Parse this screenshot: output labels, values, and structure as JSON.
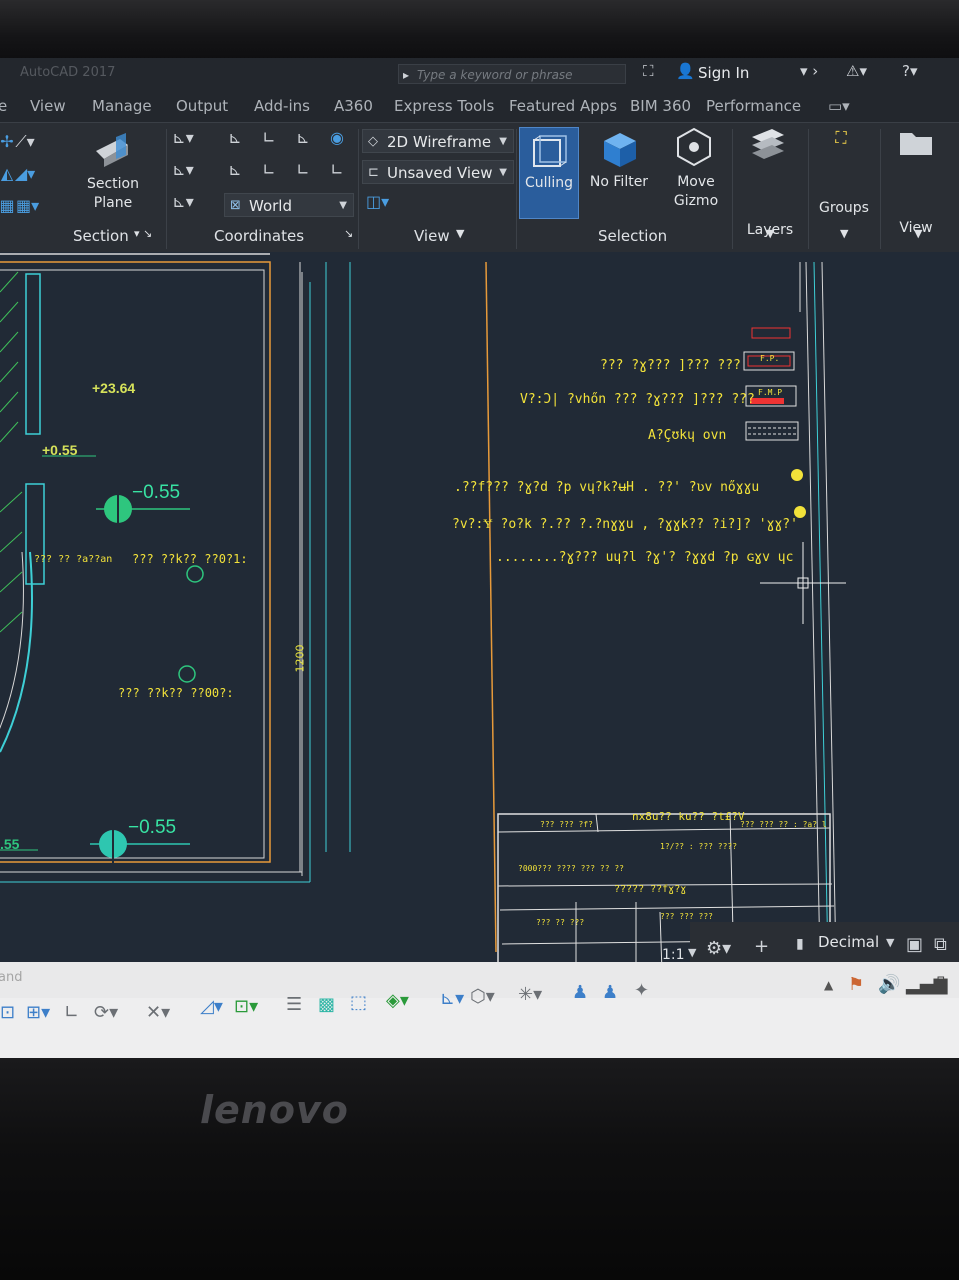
{
  "titlebar": {
    "search_placeholder": "Type a keyword or phrase",
    "sign_in": "Sign In"
  },
  "tabs": [
    "View",
    "Manage",
    "Output",
    "Add-ins",
    "A360",
    "Express Tools",
    "Featured Apps",
    "BIM 360",
    "Performance"
  ],
  "ribbon": {
    "section_plane_line1": "Section",
    "section_plane_line2": "Plane",
    "section_panel": "Section",
    "coordinates_panel": "Coordinates",
    "world": "World",
    "visual_style": "2D Wireframe",
    "named_view": "Unsaved View",
    "view_panel": "View",
    "culling": "Culling",
    "no_filter": "No Filter",
    "move_gizmo_line1": "Move",
    "move_gizmo_line2": "Gizmo",
    "selection_panel": "Selection",
    "layers": "Layers",
    "groups": "Groups",
    "view_btn": "View"
  },
  "drawing": {
    "level_1": "+23.64",
    "level_2": "+0.55",
    "level_3": "−0.55",
    "level_4": "−0.55",
    "level_5": ".55",
    "dim_1200": "1200",
    "legend_fp": "F.P.",
    "legend_fmp": "F.M.P",
    "title_block_header": "nx8u?? ku?? ?t£?V"
  },
  "statusbar": {
    "units": "Decimal",
    "scale": "1:1",
    "command_placeholder": "and"
  },
  "laptop": {
    "brand": "lenovo"
  }
}
